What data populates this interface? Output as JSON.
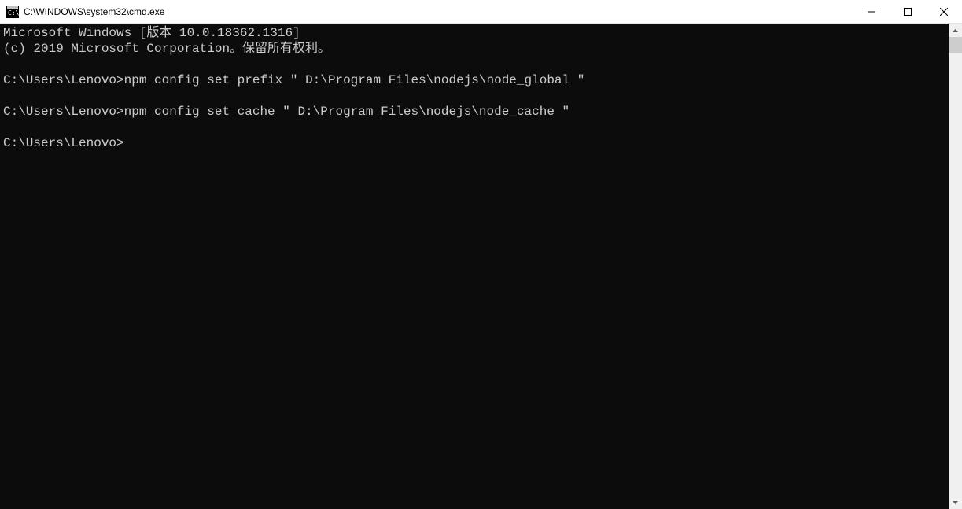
{
  "titlebar": {
    "title": "C:\\WINDOWS\\system32\\cmd.exe"
  },
  "console": {
    "header_line1": "Microsoft Windows [版本 10.0.18362.1316]",
    "header_line2": "(c) 2019 Microsoft Corporation。保留所有权利。",
    "prompt1": "C:\\Users\\Lenovo>",
    "command1": "npm config set prefix ″ D:\\Program Files\\nodejs\\node_global ″",
    "prompt2": "C:\\Users\\Lenovo>",
    "command2": "npm config set cache ″ D:\\Program Files\\nodejs\\node_cache ″",
    "prompt3": "C:\\Users\\Lenovo>"
  }
}
